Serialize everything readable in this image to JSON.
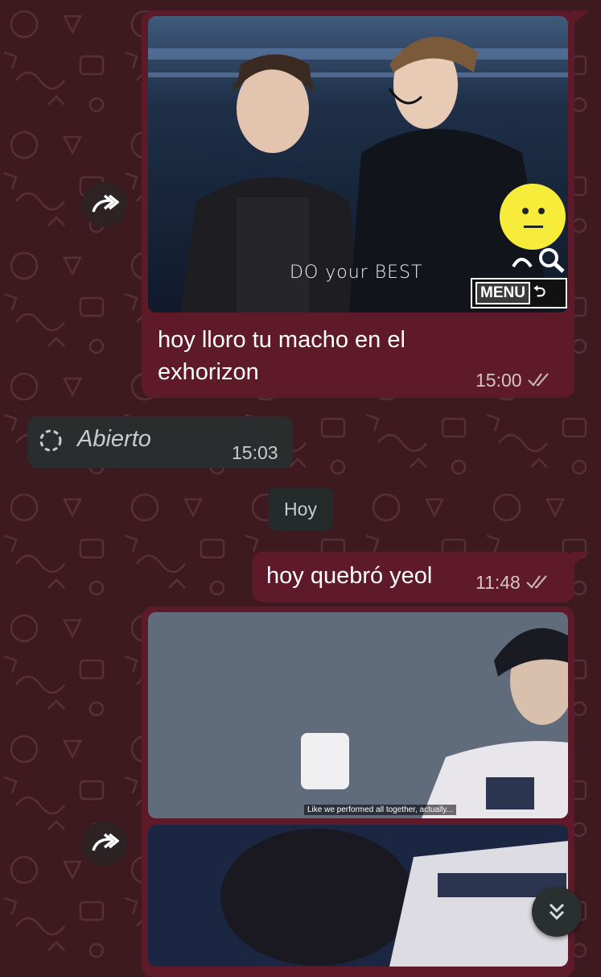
{
  "messages": [
    {
      "id": "msg1",
      "direction": "outgoing",
      "image_overlay": {
        "caption_overlay": "DO your BEST",
        "menu_label": "MENU"
      },
      "text": "hoy lloro tu macho en el exhorizon",
      "text_line1": "hoy lloro tu macho en el",
      "text_line2": "exhorizon",
      "time": "15:00",
      "status": "read"
    },
    {
      "id": "msg2",
      "direction": "incoming",
      "text": "Abierto",
      "time": "15:03"
    },
    {
      "id": "msg3",
      "direction": "outgoing",
      "text": "hoy quebró yeol",
      "time": "11:48",
      "status": "read"
    },
    {
      "id": "msg4",
      "direction": "outgoing",
      "image_overlay": {
        "subtitle": "Like we performed all together, actually..."
      }
    }
  ],
  "day_divider": "Hoy",
  "icons": {
    "forward": "forward-icon",
    "read_ticks": "double-check-icon",
    "view_once": "view-once-icon",
    "scroll_down": "chevron-double-down-icon"
  },
  "colors": {
    "background": "#3d1a20",
    "outgoing_bubble": "#5e1a28",
    "incoming_bubble": "#2a2d2d",
    "text": "#ffffff"
  }
}
